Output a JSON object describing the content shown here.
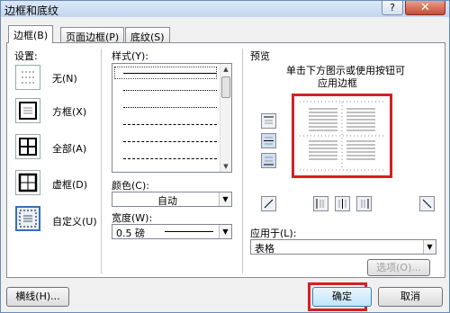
{
  "window": {
    "title": "边框和底纹",
    "help": "?",
    "close": "✕"
  },
  "tabs": [
    "边框(B)",
    "页面边框(P)",
    "底纹(S)"
  ],
  "settings": {
    "heading": "设置:",
    "items": [
      "无(N)",
      "方框(X)",
      "全部(A)",
      "虚框(D)",
      "自定义(U)"
    ],
    "selected": 4
  },
  "style": {
    "label": "样式(Y):"
  },
  "color": {
    "label": "颜色(C):",
    "value": "自动"
  },
  "width": {
    "label": "宽度(W):",
    "value": "0.5 磅"
  },
  "preview": {
    "heading": "预览",
    "hint_line1": "单击下方图示或使用按钮可",
    "hint_line2": "应用边框"
  },
  "apply_to": {
    "label": "应用于(L):",
    "value": "表格"
  },
  "options_button": "选项(O)...",
  "footer": {
    "horizontal_line": "横线(H)...",
    "ok": "确定",
    "cancel": "取消"
  }
}
